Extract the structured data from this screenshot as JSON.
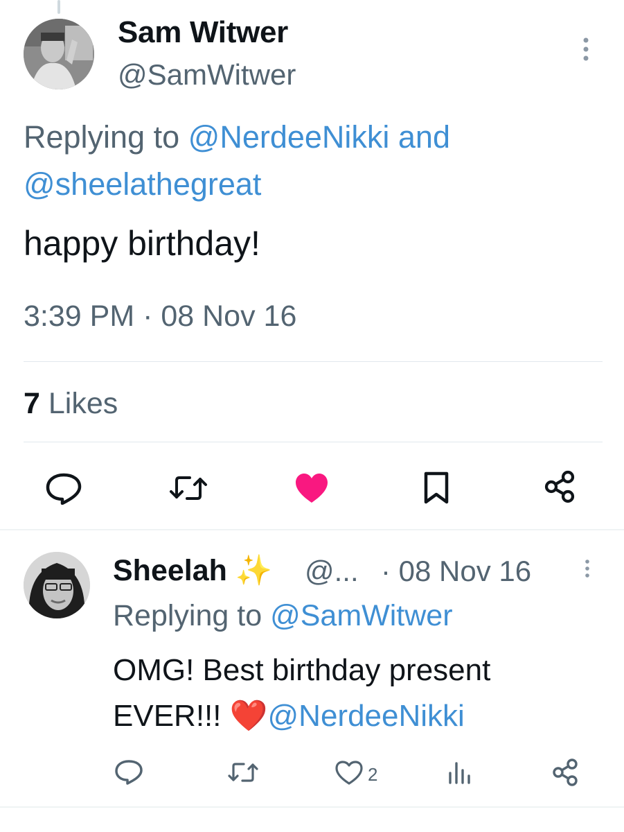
{
  "tweet": {
    "author": {
      "name": "Sam Witwer",
      "handle": "@SamWitwer"
    },
    "replying_prefix": "Replying to ",
    "replying_to_1": "@NerdeeNikki",
    "replying_joiner": " and",
    "replying_to_2": "@sheelathegreat",
    "text": "happy birthday!",
    "timestamp": "3:39 PM · 08 Nov 16",
    "likes_count": "7",
    "likes_label": " Likes",
    "liked": true,
    "icons": {
      "reply": "reply-icon",
      "retweet": "retweet-icon",
      "like": "heart-filled-icon",
      "bookmark": "bookmark-icon",
      "share": "share-icon",
      "more": "more-vertical-icon"
    },
    "colors": {
      "link": "#3f8fd4",
      "like": "#f91880",
      "secondary_text": "#536471"
    }
  },
  "reply": {
    "author": {
      "name": "Sheelah ✨",
      "handle": "@...",
      "date": "· 08 Nov 16"
    },
    "replying_prefix": "Replying to ",
    "replying_to": "@SamWitwer",
    "text_line1": "OMG! Best birthday present",
    "text_line2": "EVER!!! ❤️",
    "mention": "@NerdeeNikki",
    "like_count": "2",
    "icons": {
      "reply": "reply-icon",
      "retweet": "retweet-icon",
      "like": "heart-outline-icon",
      "views": "views-chart-icon",
      "share": "share-icon",
      "more": "more-vertical-icon"
    }
  }
}
